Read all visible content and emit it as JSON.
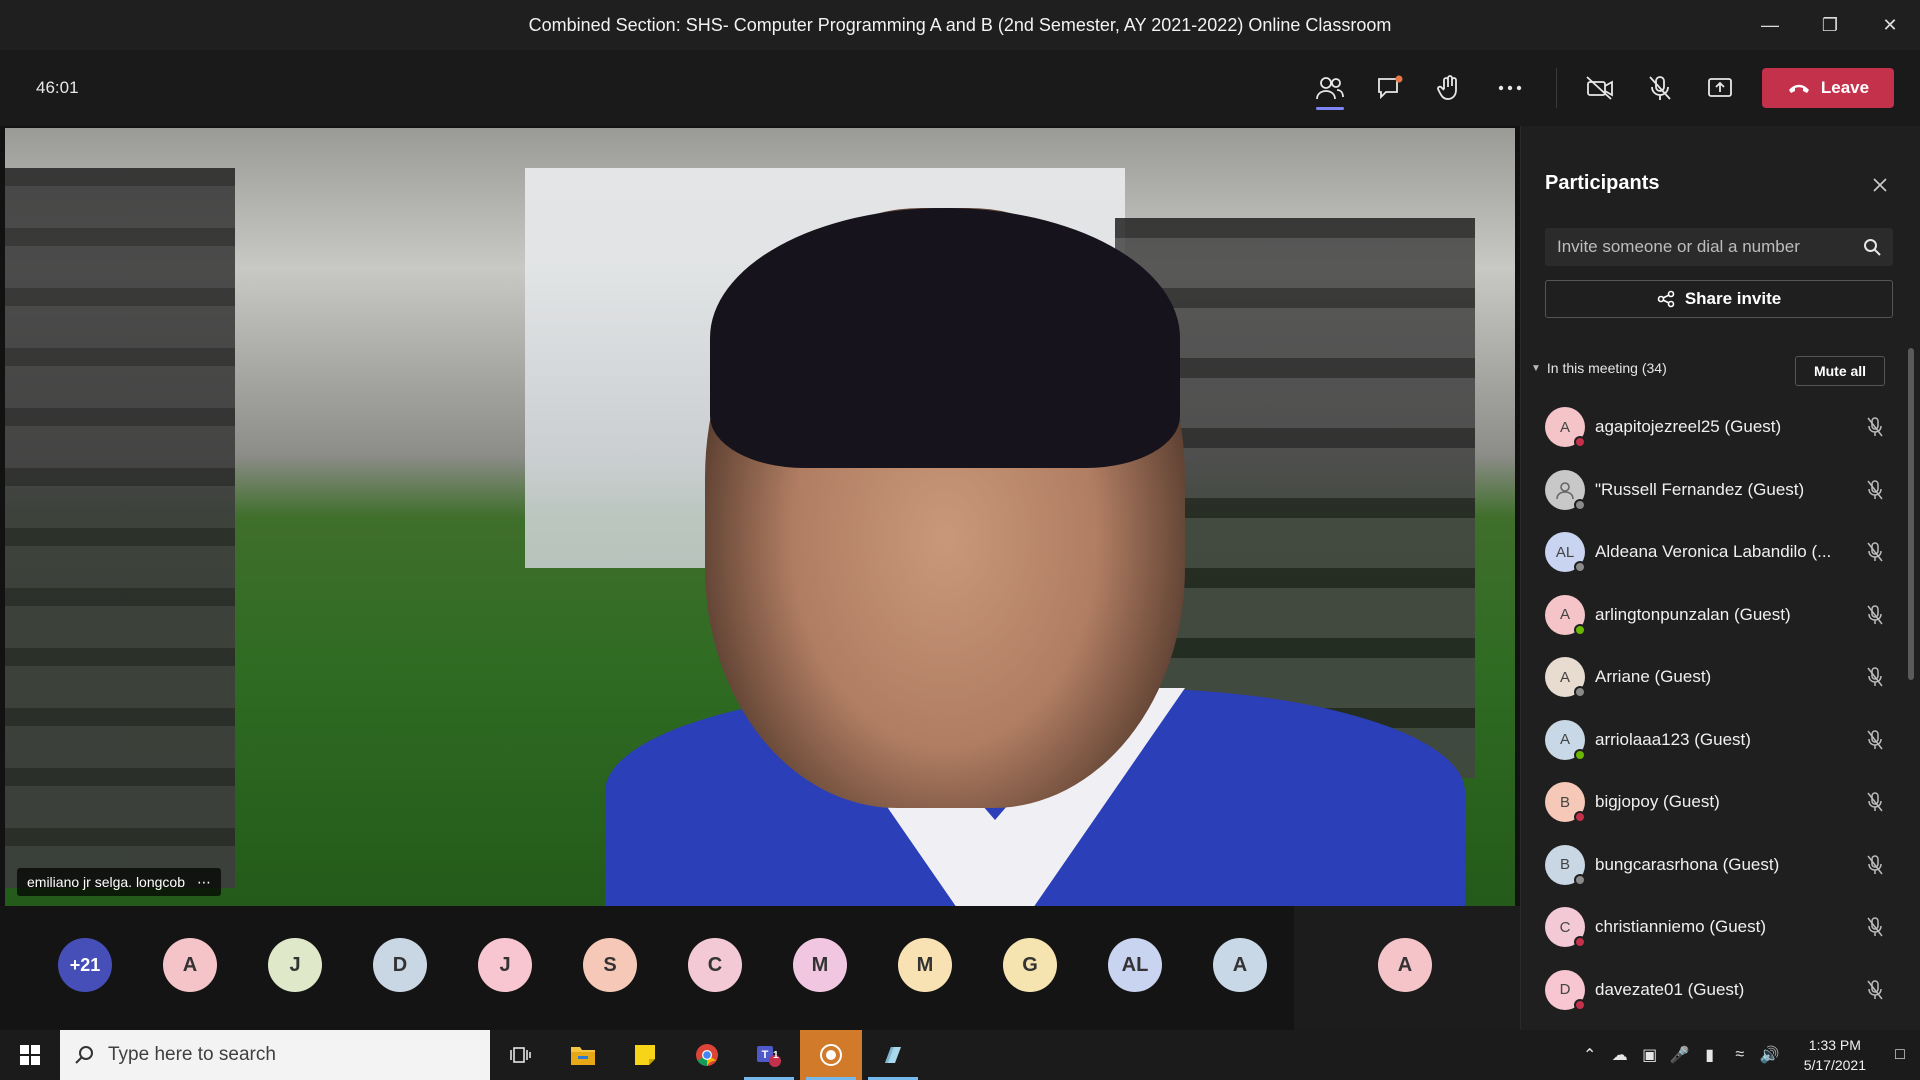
{
  "window": {
    "title": "Combined Section: SHS- Computer Programming A and B (2nd Semester, AY 2021-2022) Online Classroom"
  },
  "toolbar": {
    "timer": "46:01",
    "leave_label": "Leave",
    "icons": [
      "people-icon",
      "chat-icon",
      "raise-hand-icon",
      "more-icon",
      "camera-off-icon",
      "mic-off-icon",
      "share-screen-icon"
    ],
    "leave_color": "#c4314b",
    "active_indicator_color": "#7f85f5"
  },
  "stage": {
    "speaker_name": "emiliano jr selga. longcob",
    "speaker_more": "⋯"
  },
  "strip": {
    "overflow_count": "+21",
    "avatars": [
      {
        "initials": "A",
        "color": "#f4c4c8"
      },
      {
        "initials": "J",
        "color": "#dfe8c8"
      },
      {
        "initials": "D",
        "color": "#c9d6e3"
      },
      {
        "initials": "J",
        "color": "#f7c6d0"
      },
      {
        "initials": "S",
        "color": "#f5c8b8"
      },
      {
        "initials": "C",
        "color": "#f3c9d6"
      },
      {
        "initials": "M",
        "color": "#f1c6e0"
      },
      {
        "initials": "M",
        "color": "#f8e2b4"
      },
      {
        "initials": "G",
        "color": "#f6e4b0"
      },
      {
        "initials": "AL",
        "color": "#c8d4f0"
      },
      {
        "initials": "A",
        "color": "#c9d8e6"
      }
    ],
    "right_avatar": {
      "initials": "A",
      "color": "#f4c4c8"
    }
  },
  "panel": {
    "title": "Participants",
    "invite_placeholder": "Invite someone or dial a number",
    "share_invite_label": "Share invite",
    "section_label": "In this meeting (34)",
    "mute_all_label": "Mute all",
    "participants": [
      {
        "initials": "A",
        "name": "agapitojezreel25 (Guest)",
        "avatar_color": "#f4c4c8",
        "status_color": "#c4314b"
      },
      {
        "initials": "",
        "name": "\"Russell Fernandez (Guest)",
        "avatar_color": "#c8c8c8",
        "status_color": "#8a8a8a"
      },
      {
        "initials": "AL",
        "name": "Aldeana Veronica Labandilo (...",
        "avatar_color": "#c8d4f0",
        "status_color": "#8a8a8a"
      },
      {
        "initials": "A",
        "name": "arlingtonpunzalan (Guest)",
        "avatar_color": "#f4c4c8",
        "status_color": "#6bb700"
      },
      {
        "initials": "A",
        "name": "Arriane (Guest)",
        "avatar_color": "#e8dcd0",
        "status_color": "#8a8a8a"
      },
      {
        "initials": "A",
        "name": "arriolaaa123 (Guest)",
        "avatar_color": "#c9d8e6",
        "status_color": "#6bb700"
      },
      {
        "initials": "B",
        "name": "bigjopoy (Guest)",
        "avatar_color": "#f5c8b8",
        "status_color": "#c4314b"
      },
      {
        "initials": "B",
        "name": "bungcarasrhona (Guest)",
        "avatar_color": "#c9d6e3",
        "status_color": "#8a8a8a"
      },
      {
        "initials": "C",
        "name": "christianniemo (Guest)",
        "avatar_color": "#f3c9d6",
        "status_color": "#c4314b"
      },
      {
        "initials": "D",
        "name": "davezate01 (Guest)",
        "avatar_color": "#f7c6d0",
        "status_color": "#c4314b"
      }
    ]
  },
  "taskbar": {
    "search_placeholder": "Type here to search",
    "time": "1:33 PM",
    "date": "5/17/2021",
    "teams_badge": "1"
  }
}
